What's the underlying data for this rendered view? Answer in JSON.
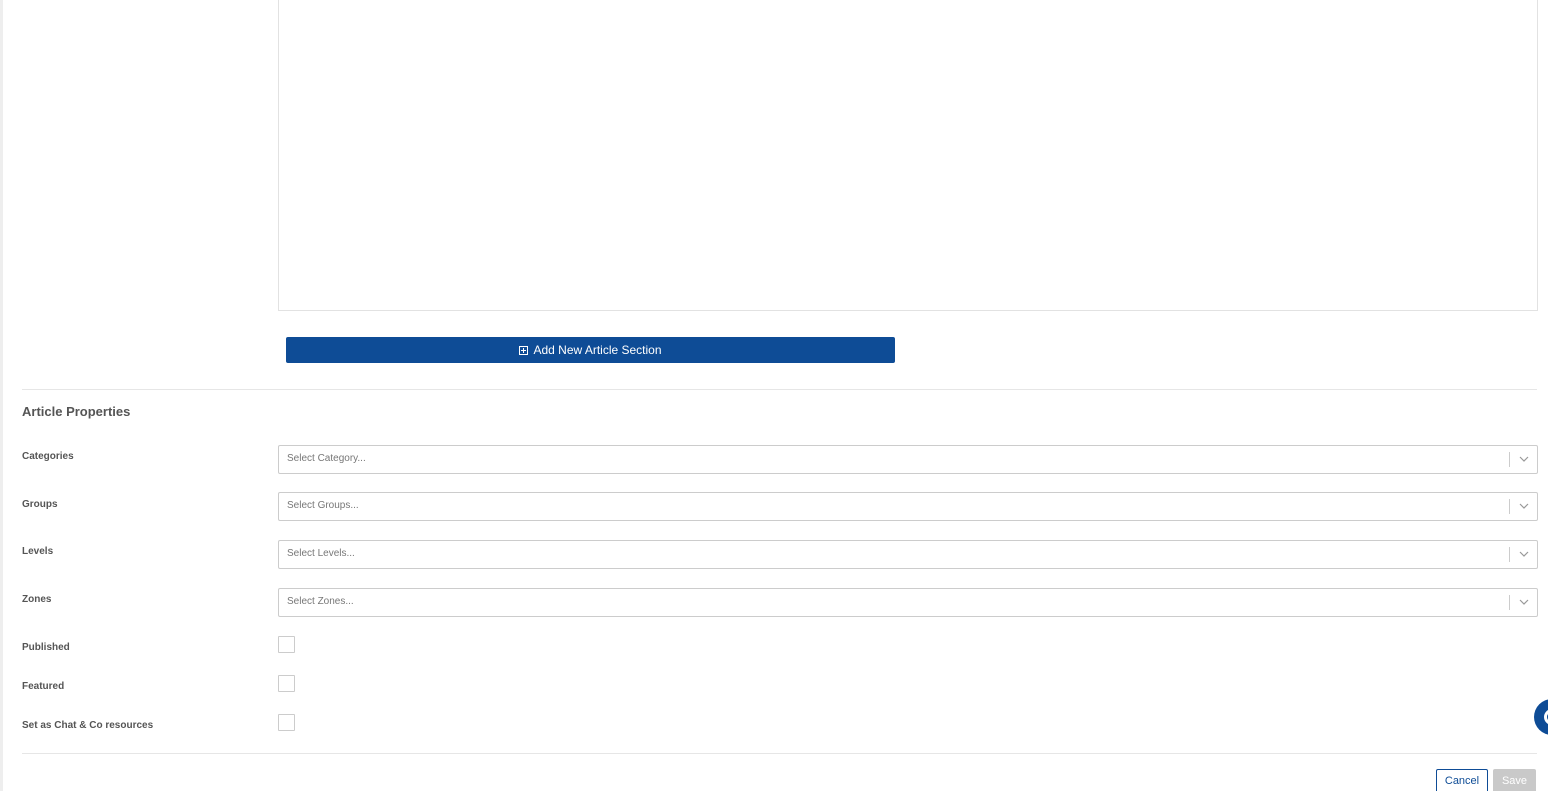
{
  "editor": {
    "add_section_label": "Add New Article Section"
  },
  "properties": {
    "title": "Article Properties",
    "fields": [
      {
        "label": "Categories",
        "placeholder": "Select Category..."
      },
      {
        "label": "Groups",
        "placeholder": "Select Groups..."
      },
      {
        "label": "Levels",
        "placeholder": "Select Levels..."
      },
      {
        "label": "Zones",
        "placeholder": "Select Zones..."
      }
    ],
    "checkboxes": [
      {
        "label": "Published",
        "checked": false
      },
      {
        "label": "Featured",
        "checked": false
      },
      {
        "label": "Set as Chat & Co resources",
        "checked": false
      }
    ]
  },
  "actions": {
    "cancel_label": "Cancel",
    "save_label": "Save",
    "save_disabled": true
  },
  "colors": {
    "primary": "#0e4c96",
    "disabled": "#c9c9c9",
    "border": "#cccccc",
    "text": "#555555"
  },
  "icons": {
    "add_section": "plus-square-icon",
    "select_toggle": "chevron-down-icon",
    "chat_widget": "chat-bubble-icon"
  }
}
